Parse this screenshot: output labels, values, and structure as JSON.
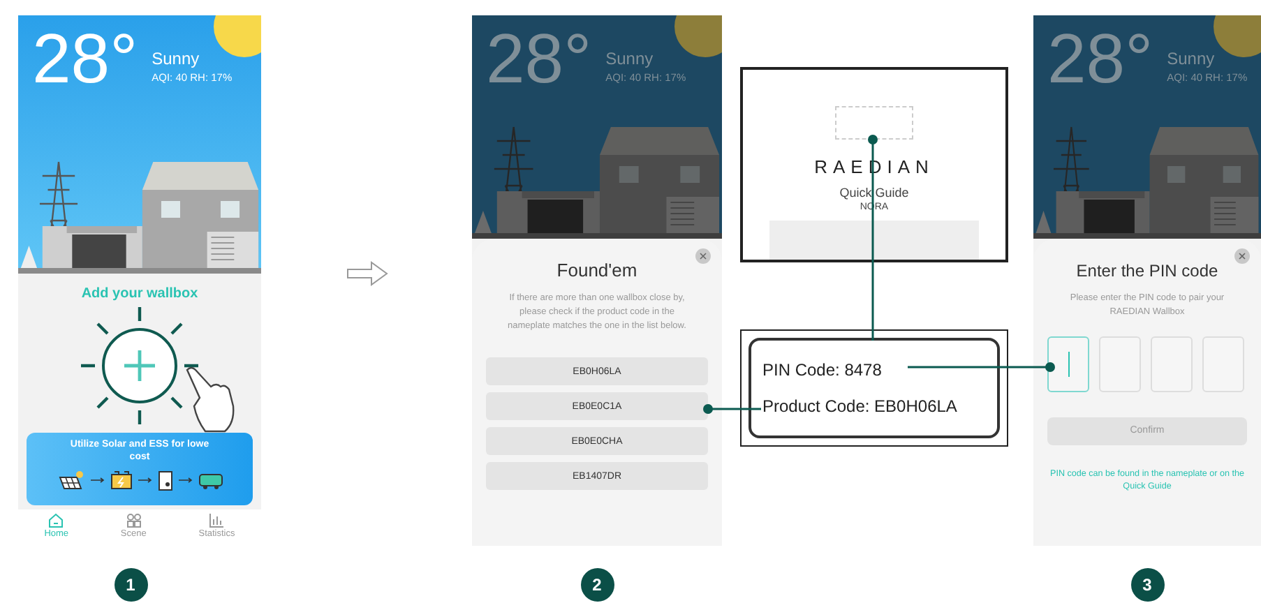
{
  "phones": [
    {
      "kind": "home",
      "weather": {
        "temperature": "28°",
        "condition": "Sunny",
        "details": "AQI: 40  RH: 17%"
      },
      "title": "Add your wallbox",
      "promo_lines": [
        "Utilize Solar and ESS for lowe",
        "cost"
      ],
      "tabs": [
        {
          "label": "Home",
          "selected": true
        },
        {
          "label": "Scene",
          "selected": false
        },
        {
          "label": "Statistics",
          "selected": false
        }
      ]
    },
    {
      "kind": "found",
      "weather": {
        "temperature": "28°",
        "condition": "Sunny",
        "details": "AQI: 40  RH: 17%"
      },
      "sheet": {
        "title": "Found'em",
        "description": "If there are more than one wallbox close by, please check if the product code in the nameplate matches the one in the list below.",
        "items": [
          "EB0H06LA",
          "EB0E0C1A",
          "EB0E0CHA",
          "EB1407DR"
        ]
      }
    },
    {
      "kind": "pin",
      "weather": {
        "temperature": "28°",
        "condition": "Sunny",
        "details": "AQI: 40  RH: 17%"
      },
      "sheet": {
        "title": "Enter the PIN code",
        "description": "Please enter the PIN code to pair your RAEDIAN Wallbox",
        "pin_boxes": [
          {
            "selected": true
          },
          {
            "selected": false
          },
          {
            "selected": false
          },
          {
            "selected": false
          }
        ],
        "button": {
          "label": "Confirm",
          "disabled": true
        },
        "hint": "PIN code can be found in the nameplate or on the Quick Guide"
      }
    }
  ],
  "guide": {
    "logo": "RAEDIAN",
    "title": "Quick Guide",
    "model": "NORA"
  },
  "nameplate": {
    "pin": "PIN Code: 8478",
    "product": "Product Code: EB0H06LA"
  },
  "steps": [
    "1",
    "2",
    "3"
  ]
}
